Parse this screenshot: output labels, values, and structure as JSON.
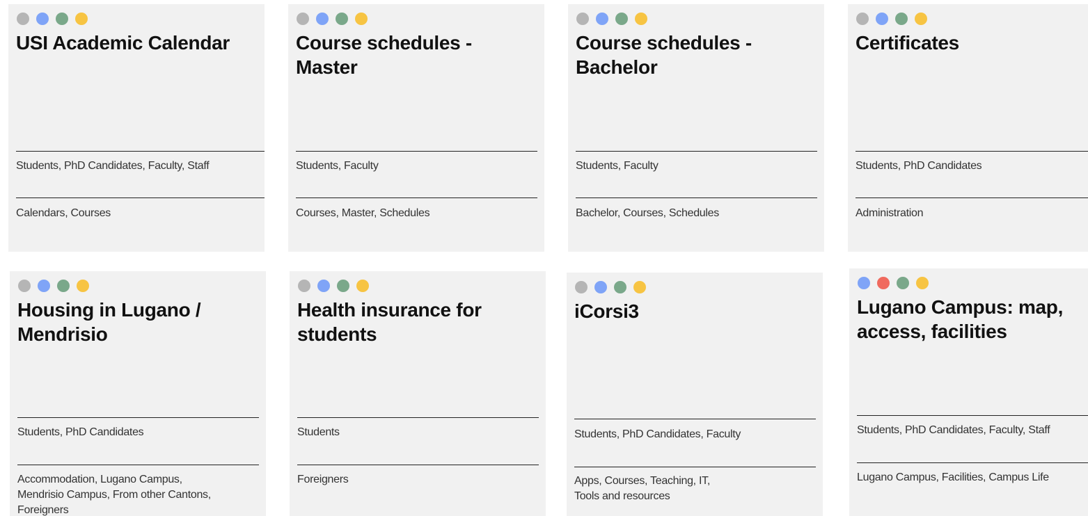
{
  "colors": {
    "card_bg": "#f1f1f1",
    "gray": "#b5b5b5",
    "blue": "#7fa4f7",
    "green": "#7aa88a",
    "yellow": "#f7c443",
    "red": "#f06a5e"
  },
  "cards": [
    {
      "title": "USI Academic Calendar",
      "audience": "Students, PhD Candidates, Faculty, Staff",
      "tags": "Calendars, Courses",
      "dots": [
        "gray",
        "blue",
        "green",
        "yellow"
      ]
    },
    {
      "title": "Course schedules - Master",
      "audience": "Students, Faculty",
      "tags": "Courses, Master, Schedules",
      "dots": [
        "gray",
        "blue",
        "green",
        "yellow"
      ]
    },
    {
      "title": "Course schedules - Bachelor",
      "audience": "Students, Faculty",
      "tags": "Bachelor, Courses, Schedules",
      "dots": [
        "gray",
        "blue",
        "green",
        "yellow"
      ]
    },
    {
      "title": "Certificates",
      "audience": "Students, PhD Candidates",
      "tags": "Administration",
      "dots": [
        "gray",
        "blue",
        "green",
        "yellow"
      ]
    },
    {
      "title": "Housing in Lugano / Mendrisio",
      "audience": "Students, PhD Candidates",
      "tags": "Accommodation, Lugano Campus,\nMendrisio Campus, From other Cantons,\nForeigners",
      "dots": [
        "gray",
        "blue",
        "green",
        "yellow"
      ]
    },
    {
      "title": "Health insurance for students",
      "audience": "Students",
      "tags": "Foreigners",
      "dots": [
        "gray",
        "blue",
        "green",
        "yellow"
      ]
    },
    {
      "title": "iCorsi3",
      "audience": "Students, PhD Candidates, Faculty",
      "tags": "Apps, Courses, Teaching, IT,\nTools and resources",
      "dots": [
        "gray",
        "blue",
        "green",
        "yellow"
      ]
    },
    {
      "title": "Lugano Campus: map, access, facilities",
      "audience": "Students, PhD Candidates, Faculty, Staff",
      "tags": "Lugano Campus, Facilities, Campus Life",
      "dots": [
        "blue",
        "red",
        "green",
        "yellow"
      ]
    }
  ]
}
